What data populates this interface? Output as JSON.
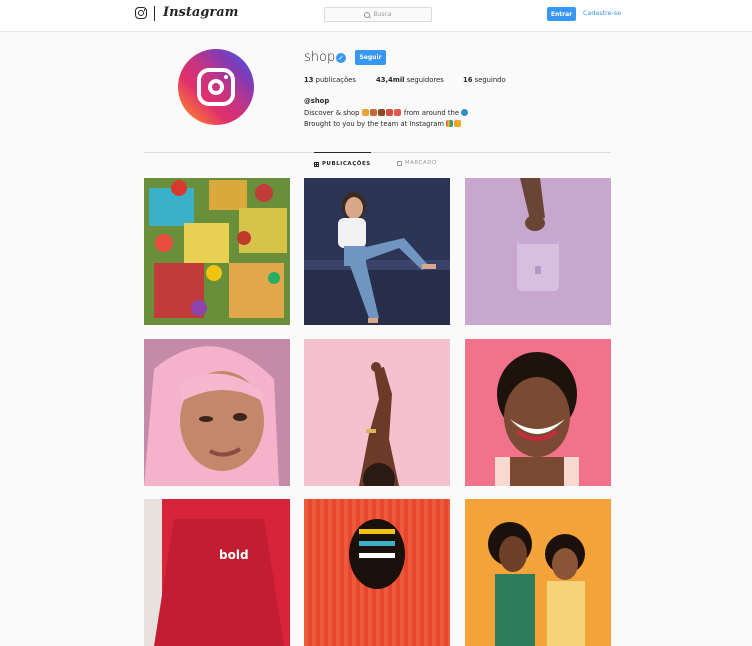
{
  "topbar": {
    "logo_text": "Instagram",
    "search_placeholder": "Busca",
    "login_label": "Entrar",
    "signup_label": "Cadastre-se"
  },
  "profile": {
    "username": "shop",
    "follow_label": "Seguir",
    "stats": {
      "posts_count": "13",
      "posts_label": "publicações",
      "followers_count": "43,4mil",
      "followers_label": "seguidores",
      "following_count": "16",
      "following_label": "seguindo"
    },
    "handle": "@shop",
    "bio_line1_start": "Discover & shop",
    "bio_line1_end": "from around the",
    "bio_line2": "Brought to you by the team at Instagram"
  },
  "tabs": {
    "posts_label": "PUBLICAÇÕES",
    "tagged_label": "MARCADO"
  },
  "colors": {
    "accent": "#3897f0",
    "text": "#262626",
    "muted": "#999999",
    "border": "#dbdbdb"
  },
  "icons": [
    "instagram-glyph-icon",
    "search-icon",
    "verified-badge-icon",
    "grid-icon",
    "tagged-icon"
  ]
}
